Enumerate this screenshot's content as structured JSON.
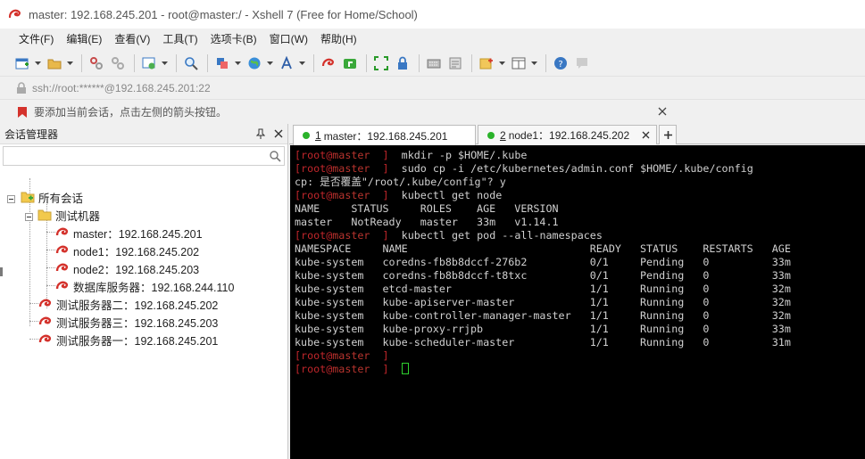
{
  "window": {
    "title": "master: 192.168.245.201 - root@master:/ - Xshell 7 (Free for Home/School)"
  },
  "menu": [
    "文件(F)",
    "编辑(E)",
    "查看(V)",
    "工具(T)",
    "选项卡(B)",
    "窗口(W)",
    "帮助(H)"
  ],
  "address_bar": {
    "text": "ssh://root:******@192.168.245.201:22"
  },
  "hint_bar": {
    "text": "要添加当前会话，点击左侧的箭头按钮。"
  },
  "session_manager": {
    "title": "会话管理器",
    "search_placeholder": "",
    "tree": {
      "root": "所有会话",
      "group": "测试机器",
      "group_sessions": [
        "master：192.168.245.201",
        "node1：192.168.245.202",
        "node2：192.168.245.203",
        "数据库服务器：192.168.244.110"
      ],
      "sessions": [
        "测试服务器二：192.168.245.202",
        "测试服务器三：192.168.245.203",
        "测试服务器一：192.168.245.201"
      ]
    }
  },
  "tabs": [
    {
      "num": "1",
      "label": "master：192.168.245.201",
      "active": true
    },
    {
      "num": "2",
      "label": "node1：192.168.245.202",
      "active": false
    }
  ],
  "terminal": {
    "prompt_user": "root",
    "prompt_host": "master",
    "lines": [
      {
        "prompt": true,
        "text": "mkdir -p $HOME/.kube"
      },
      {
        "prompt": true,
        "text": "sudo cp -i /etc/kubernetes/admin.conf $HOME/.kube/config"
      },
      {
        "prompt": false,
        "text": "cp: 是否覆盖\"/root/.kube/config\"? y"
      },
      {
        "prompt": true,
        "text": "kubectl get node"
      },
      {
        "prompt": false,
        "text": "NAME     STATUS     ROLES    AGE   VERSION"
      },
      {
        "prompt": false,
        "text": "master   NotReady   master   33m   v1.14.1"
      },
      {
        "prompt": true,
        "text": "kubectl get pod --all-namespaces"
      },
      {
        "prompt": false,
        "text": "NAMESPACE     NAME                             READY   STATUS    RESTARTS   AGE"
      },
      {
        "prompt": false,
        "text": "kube-system   coredns-fb8b8dccf-276b2          0/1     Pending   0          33m"
      },
      {
        "prompt": false,
        "text": "kube-system   coredns-fb8b8dccf-t8txc          0/1     Pending   0          33m"
      },
      {
        "prompt": false,
        "text": "kube-system   etcd-master                      1/1     Running   0          32m"
      },
      {
        "prompt": false,
        "text": "kube-system   kube-apiserver-master            1/1     Running   0          32m"
      },
      {
        "prompt": false,
        "text": "kube-system   kube-controller-manager-master   1/1     Running   0          32m"
      },
      {
        "prompt": false,
        "text": "kube-system   kube-proxy-rrjpb                 1/1     Running   0          33m"
      },
      {
        "prompt": false,
        "text": "kube-system   kube-scheduler-master            1/1     Running   0          31m"
      },
      {
        "prompt": true,
        "text": ""
      },
      {
        "prompt": true,
        "text": "",
        "cursor": true
      }
    ]
  },
  "colors": {
    "accent_red": "#c0262b",
    "active_dot": "#2bb32b",
    "terminal_bg": "#000000",
    "cursor": "#2ed12e"
  }
}
